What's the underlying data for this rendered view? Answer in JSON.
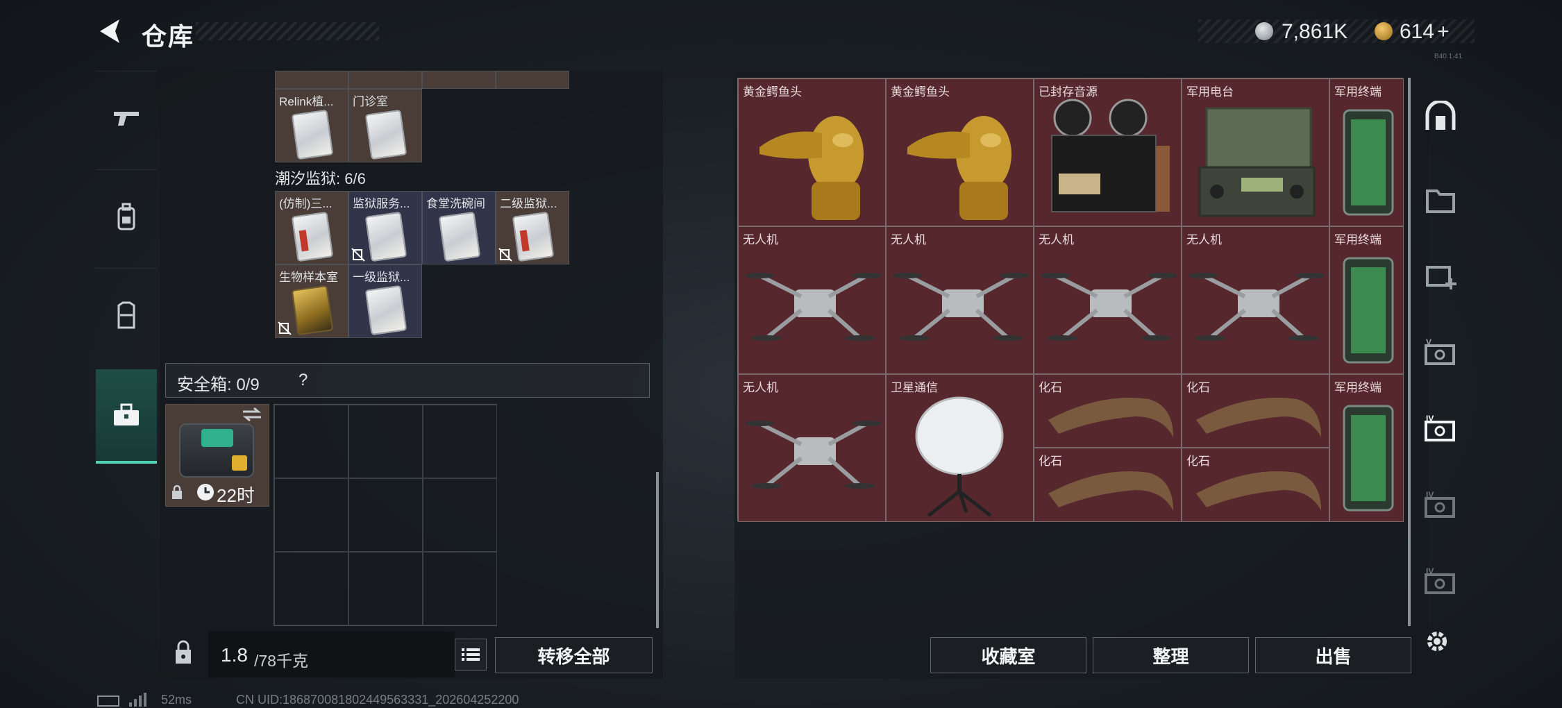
{
  "header": {
    "title": "仓库",
    "silver_value": "7,861K",
    "gold_value": "614",
    "gold_add": "+",
    "version": "B40.1.41"
  },
  "left_tabs": [
    {
      "name": "weapons",
      "icon": "pistol-icon"
    },
    {
      "name": "gear",
      "icon": "backpack-icon"
    },
    {
      "name": "armor",
      "icon": "vest-icon"
    },
    {
      "name": "cases",
      "icon": "toolbox-icon",
      "active": true
    }
  ],
  "keycards": {
    "row_top": [
      {
        "label": "Relink植..."
      },
      {
        "label": "门诊室"
      }
    ],
    "section": "潮汐监狱: 6/6",
    "row_a": [
      {
        "label": "(仿制)三..."
      },
      {
        "label": "监狱服务..."
      },
      {
        "label": "食堂洗碗间"
      },
      {
        "label": "二级监狱..."
      }
    ],
    "row_b": [
      {
        "label": "生物样本室"
      },
      {
        "label": "一级监狱..."
      }
    ]
  },
  "safe": {
    "label": "安全箱: 0/9",
    "help": "?",
    "time": "22时"
  },
  "footer_left": {
    "weight_value": "1.8",
    "weight_unit": "/78千克",
    "transfer_all": "转移全部"
  },
  "items": [
    {
      "label": "黄金鳄鱼头"
    },
    {
      "label": "黄金鳄鱼头"
    },
    {
      "label": "已封存音源"
    },
    {
      "label": "军用电台"
    },
    {
      "label": "军用终端"
    },
    {
      "label": "无人机"
    },
    {
      "label": "无人机"
    },
    {
      "label": "无人机"
    },
    {
      "label": "无人机"
    },
    {
      "label": "军用终端"
    },
    {
      "label": "无人机"
    },
    {
      "label": "卫星通信"
    },
    {
      "label": "化石"
    },
    {
      "label": "化石"
    },
    {
      "label": "军用终端"
    },
    {
      "label": "化石"
    },
    {
      "label": "化石"
    }
  ],
  "right_tabs": [
    "vault-icon",
    "folder-icon",
    "medkit-add-icon",
    "tier5-card-icon",
    "tier4-card-icon",
    "tier4-card-icon",
    "tier4-card-icon"
  ],
  "footer_right": {
    "collection": "收藏室",
    "sort": "整理",
    "sell": "出售"
  },
  "status": {
    "ping": "52ms",
    "uid": "CN UID:186870081802449563331_202604252200"
  },
  "colors": {
    "accent": "#4fd1b4",
    "item_bg": "#56282e",
    "keycard_brown": "#4a3d37",
    "keycard_navy": "#32344a"
  }
}
